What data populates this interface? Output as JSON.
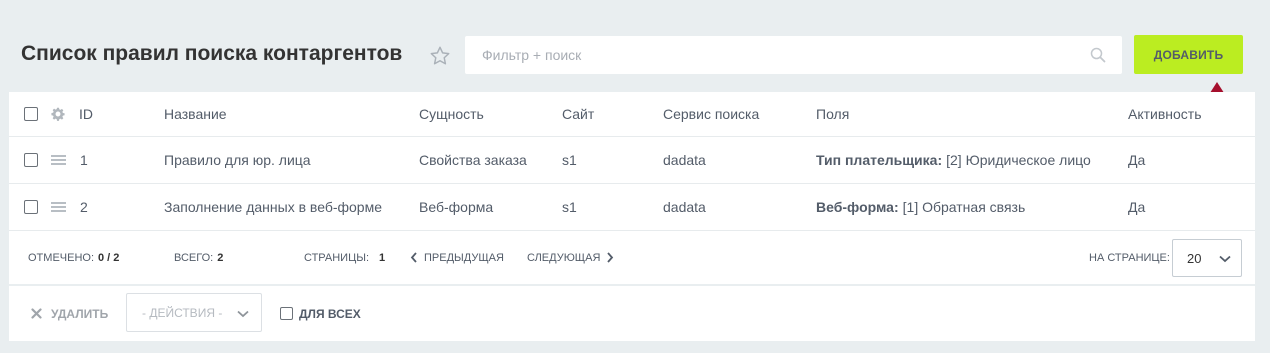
{
  "header": {
    "title": "Список правил поиска контаргентов",
    "search_placeholder": "Фильтр + поиск",
    "add_label": "ДОБАВИТЬ"
  },
  "table": {
    "columns": [
      "ID",
      "Название",
      "Сущность",
      "Сайт",
      "Сервис поиска",
      "Поля",
      "Активность"
    ],
    "rows": [
      {
        "id": "1",
        "name": "Правило для юр. лица",
        "entity": "Свойства заказа",
        "site": "s1",
        "service": "dadata",
        "fields_label": "Тип плательщика:",
        "fields_value": "[2] Юридическое лицо",
        "active": "Да"
      },
      {
        "id": "2",
        "name": "Заполнение данных в веб-форме",
        "entity": "Веб-форма",
        "site": "s1",
        "service": "dadata",
        "fields_label": "Веб-форма:",
        "fields_value": "[1] Обратная связь",
        "active": "Да"
      }
    ]
  },
  "pagination": {
    "selected_label": "ОТМЕЧЕНО:",
    "selected_value": "0 / 2",
    "total_label": "ВСЕГО:",
    "total_value": "2",
    "pages_label": "СТРАНИЦЫ:",
    "pages_value": "1",
    "prev_label": "ПРЕДЫДУЩАЯ",
    "next_label": "СЛЕДУЮЩАЯ",
    "per_page_label": "НА СТРАНИЦЕ:",
    "per_page_value": "20"
  },
  "footer": {
    "delete_label": "УДАЛИТЬ",
    "actions_placeholder": "- ДЕЙСТВИЯ -",
    "for_all_label": "ДЛЯ ВСЕХ"
  },
  "colors": {
    "accent": "#bbed21",
    "arrow": "#a50f2d",
    "background": "#e9eef0"
  }
}
